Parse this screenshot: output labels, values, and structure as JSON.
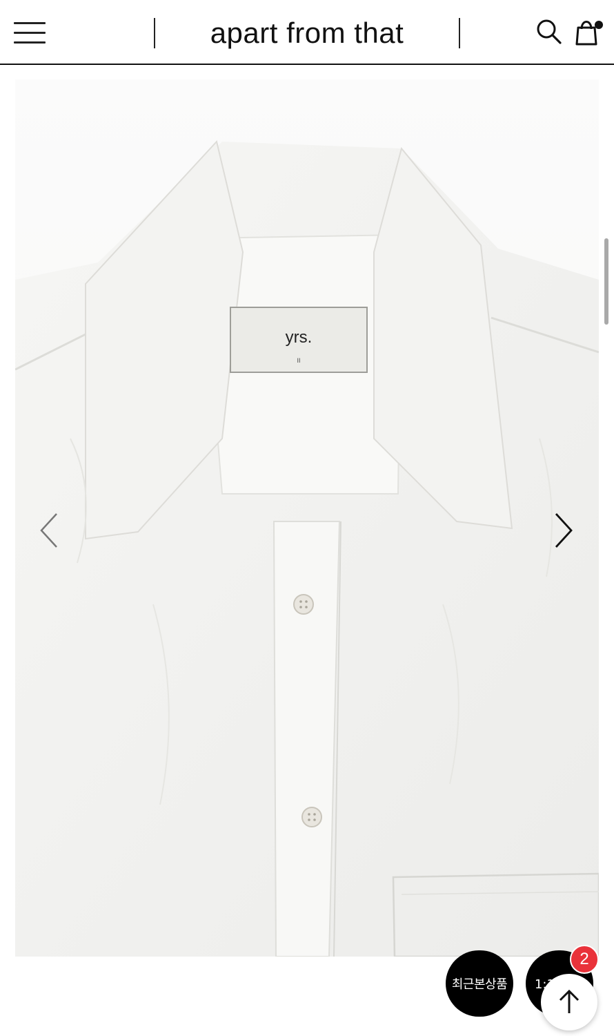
{
  "header": {
    "brand": "apart from that",
    "icons": {
      "menu": "hamburger-menu-icon",
      "search": "search-icon",
      "cart": "shopping-bag-icon"
    },
    "cart_dot_color": "#111111"
  },
  "gallery": {
    "label_text": "yrs.",
    "label_subtext": "II",
    "icons": {
      "prev": "chevron-left-icon",
      "next": "chevron-right-icon"
    }
  },
  "floating": {
    "recent_label": "최근본상품",
    "chat_label": "1:1문의",
    "badge_count": "2",
    "badge_color": "#e9323a",
    "top_icon": "arrow-up-icon"
  }
}
